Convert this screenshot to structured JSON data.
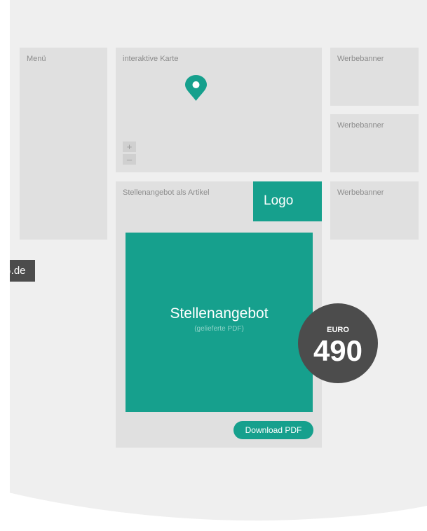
{
  "sidebar": {
    "label": "Menü"
  },
  "map": {
    "label": "interaktive Karte",
    "zoom_in": "+",
    "zoom_out": "–"
  },
  "banners": [
    {
      "label": "Werbebanner"
    },
    {
      "label": "Werbebanner"
    },
    {
      "label": "Werbebanner"
    }
  ],
  "article": {
    "label": "Stellenangebot als Artikel",
    "logo": "Logo",
    "main_title": "Stellenangebot",
    "main_subtitle": "(gelieferte PDF)",
    "download_label": "Download PDF"
  },
  "price": {
    "currency": "EURO",
    "amount": "490"
  },
  "edge_tag": "G.de",
  "colors": {
    "accent": "#16a08d",
    "badge": "#4c4c4c",
    "panel": "#e0e0e0",
    "page": "#efefef"
  }
}
